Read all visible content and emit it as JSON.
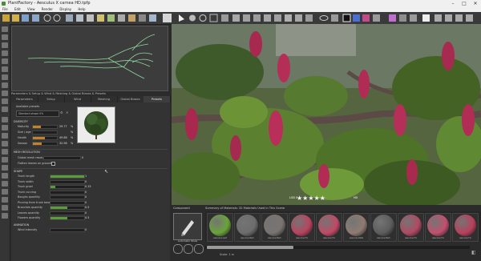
{
  "window": {
    "title": "PlantFactory - Aesculus X carnea HD.tpfp"
  },
  "menu": [
    "File",
    "Edit",
    "View",
    "Render",
    "Display",
    "Help"
  ],
  "properties": {
    "header": "Parameters & Setup & Wind & Meshing & Global Biases & Presets",
    "tabs": [
      "Parameters",
      "Setup",
      "Wind",
      "Meshing",
      "Global Biases",
      "Presets"
    ],
    "active_tab": "Presets",
    "available_presets_label": "Available presets",
    "preset_value": "Standard shape 0%",
    "diversity": {
      "title": "DIVERSITY",
      "rows": [
        {
          "label": "Maturity",
          "value": "29.77",
          "unit": "%",
          "level": 0.3
        },
        {
          "label": "Size / age",
          "value": "",
          "unit": "%",
          "level": 0.0
        },
        {
          "label": "Health",
          "value": "49.88",
          "unit": "%",
          "level": 0.5
        },
        {
          "label": "Season",
          "value": "32.98",
          "unit": "%",
          "level": 0.33
        }
      ]
    },
    "mesh": {
      "title": "MESH RESOLUTION",
      "global_label": "Global mesh resolution",
      "global_value": "0",
      "flatten_label": "Flatten leaves on ground"
    },
    "shape": {
      "title": "SHAPE",
      "rows": [
        {
          "label": "Trunk length",
          "value": "1",
          "level": 1.0
        },
        {
          "label": "Trunk width",
          "value": "0",
          "level": 0.0
        },
        {
          "label": "Trunk gnarl",
          "value": "0.15",
          "level": 0.15
        },
        {
          "label": "Trunk curving",
          "value": "0",
          "level": 0.0
        },
        {
          "label": "Boughs quantity",
          "value": "0",
          "level": 0.0
        },
        {
          "label": "Pruning from trunk base",
          "value": "0",
          "level": 0.0
        },
        {
          "label": "Branches quantity",
          "value": "0.5",
          "level": 0.5
        },
        {
          "label": "Leaves quantity",
          "value": "0",
          "level": 0.0
        },
        {
          "label": "Flowers quantity",
          "value": "0.5",
          "level": 0.5
        }
      ]
    },
    "animation": {
      "title": "ANIMATION",
      "rows": [
        {
          "label": "Wind intensity",
          "value": "0",
          "level": 0.0
        }
      ]
    }
  },
  "viewport": {
    "lod_label": "LOD 0",
    "stars": "★★★★★",
    "rating_value": "HD"
  },
  "bottom": {
    "component_header": "Component",
    "materials_header": "Summary of Materials: 32 Materials Used in This Scene",
    "component_label": "Automatic Mode",
    "materials": [
      {
        "caption": "Aesculus Leaf",
        "color": "#6aa33a"
      },
      {
        "caption": "Aesculus Bark",
        "color": "#6d6d6d"
      },
      {
        "caption": "Aesculus Bark",
        "color": "#7a7470"
      },
      {
        "caption": "Aesculus Flo",
        "color": "#b8445f"
      },
      {
        "caption": "Aesculus Flo",
        "color": "#c14a66"
      },
      {
        "caption": "Aesculus Petal",
        "color": "#8f7b72"
      },
      {
        "caption": "Aesculus Bark",
        "color": "#5d5d5d"
      },
      {
        "caption": "Aesculus Flo",
        "color": "#b04a63"
      },
      {
        "caption": "Aesculus Flo",
        "color": "#c25070"
      },
      {
        "caption": "Aesculus Flo",
        "color": "#b9405c"
      }
    ]
  },
  "status": {
    "zoom": "Scale: 1 m"
  }
}
